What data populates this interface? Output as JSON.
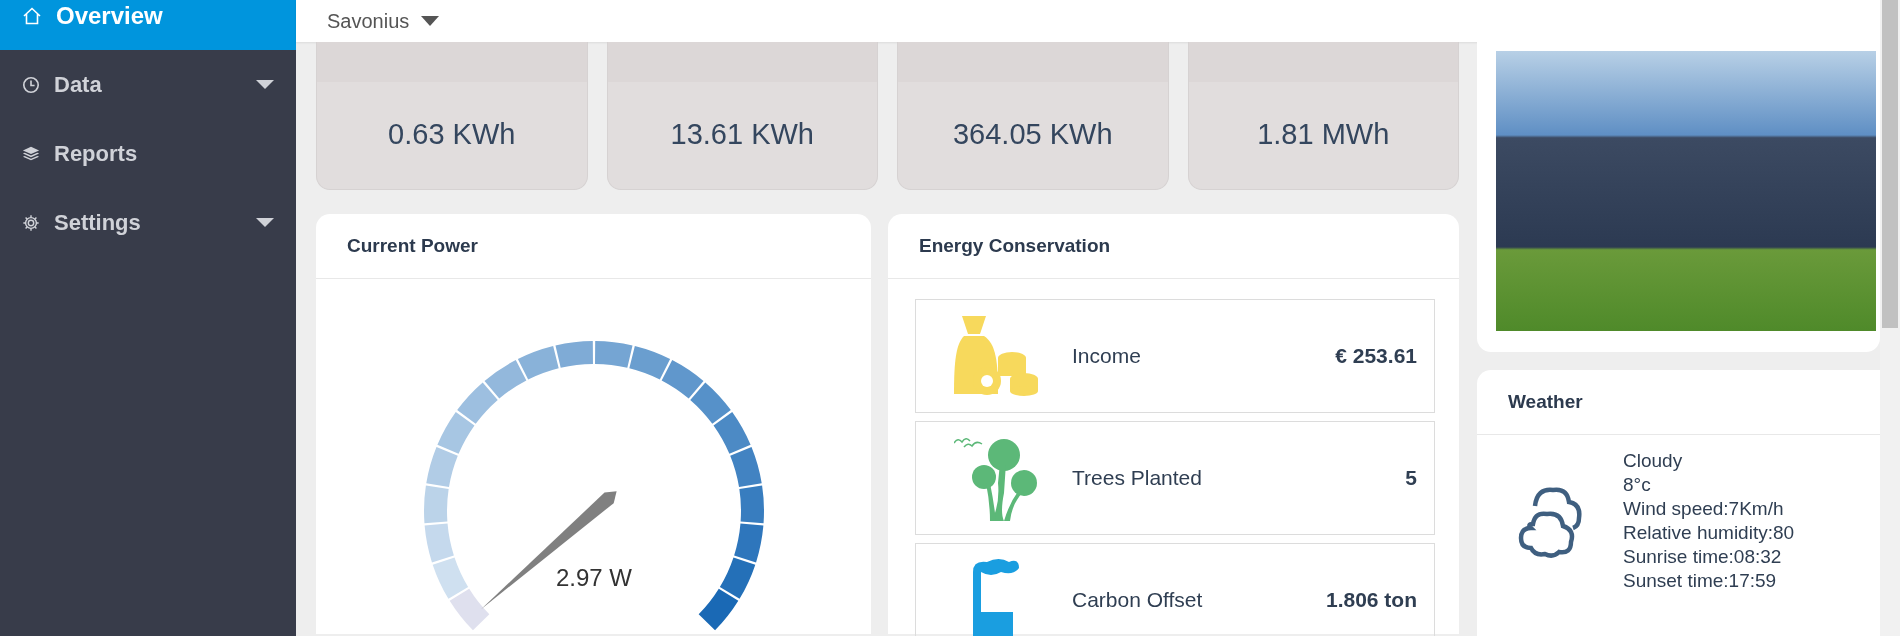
{
  "sidebar": {
    "items": [
      {
        "label": "Overview",
        "selected": true,
        "expandable": false
      },
      {
        "label": "Data",
        "selected": false,
        "expandable": true
      },
      {
        "label": "Reports",
        "selected": false,
        "expandable": false
      },
      {
        "label": "Settings",
        "selected": false,
        "expandable": true
      }
    ]
  },
  "header": {
    "site_selector": "Savonius"
  },
  "summary_cards": [
    {
      "value": "0.63 KWh"
    },
    {
      "value": "13.61 KWh"
    },
    {
      "value": "364.05 KWh"
    },
    {
      "value": "1.81 MWh"
    }
  ],
  "current_power": {
    "title": "Current Power",
    "reading": "2.97 W"
  },
  "energy_conservation": {
    "title": "Energy Conservation",
    "items": [
      {
        "label": "Income",
        "value": "€ 253.61"
      },
      {
        "label": "Trees Planted",
        "value": "5"
      },
      {
        "label": "Carbon Offset",
        "value": "1.806 ton"
      }
    ]
  },
  "weather": {
    "title": "Weather",
    "lines": [
      "Cloudy",
      "8°c",
      "Wind speed:7Km/h",
      "Relative humidity:80",
      "Sunrise time:08:32",
      "Sunset time:17:59"
    ]
  }
}
